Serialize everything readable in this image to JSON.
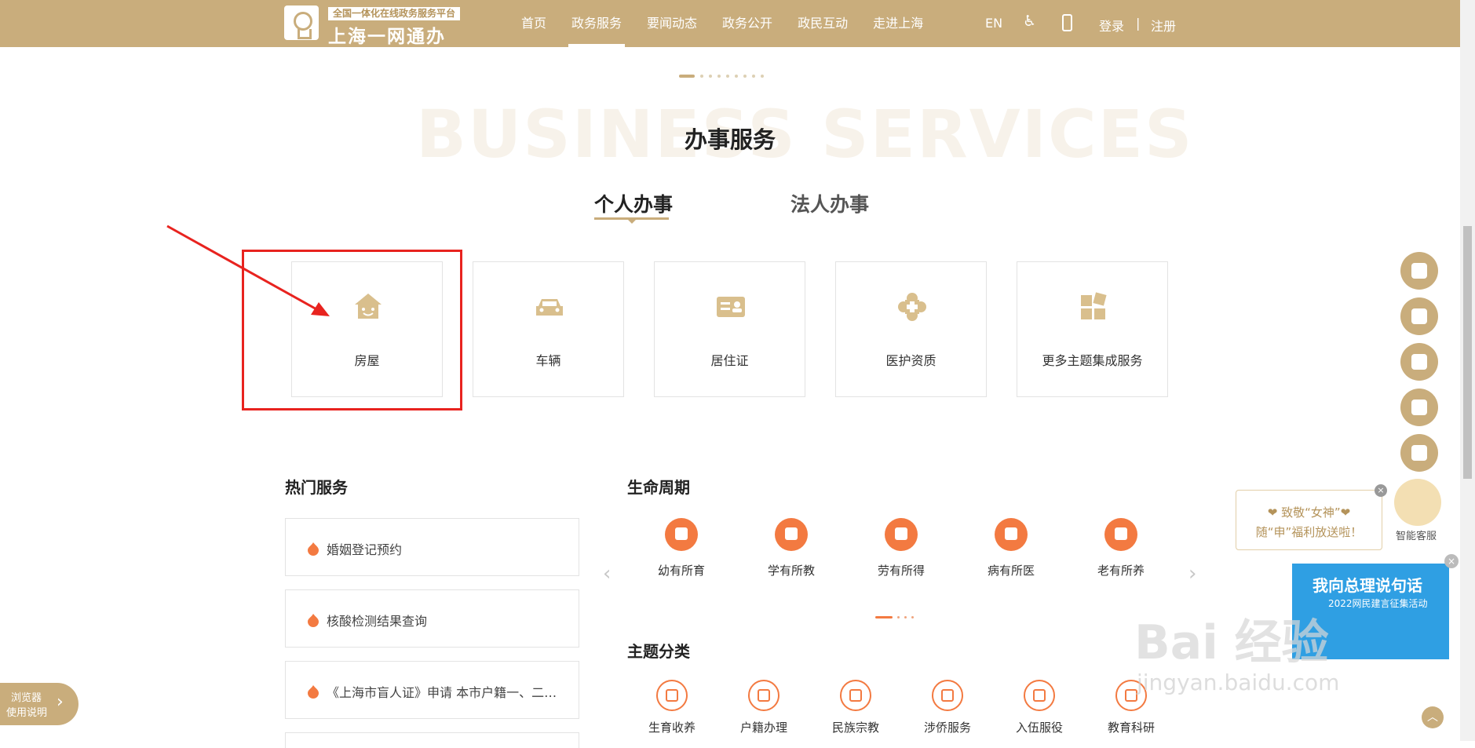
{
  "header": {
    "logo_tagline": "全国一体化在线政务服务平台",
    "logo_name": "上海一网通办",
    "nav": [
      "首页",
      "政务服务",
      "要闻动态",
      "政务公开",
      "政民互动",
      "走进上海"
    ],
    "active_nav": "政务服务",
    "lang": "EN",
    "login": "登录",
    "separator": "|",
    "register": "注册"
  },
  "section": {
    "bg_title": "BUSINESS SERVICES",
    "title": "办事服务",
    "tabs": [
      "个人办事",
      "法人办事"
    ],
    "active_tab": "个人办事"
  },
  "cards": [
    {
      "label": "房屋",
      "icon": "house-icon"
    },
    {
      "label": "车辆",
      "icon": "car-icon"
    },
    {
      "label": "居住证",
      "icon": "id-card-icon"
    },
    {
      "label": "医护资质",
      "icon": "medical-cross-icon"
    },
    {
      "label": "更多主题集成服务",
      "icon": "grid-icon"
    }
  ],
  "hot": {
    "title": "热门服务",
    "items": [
      "婚姻登记预约",
      "核酸检测结果查询",
      "《上海市盲人证》申请 本市户籍一、二…"
    ]
  },
  "life": {
    "title": "生命周期",
    "items": [
      "幼有所育",
      "学有所教",
      "劳有所得",
      "病有所医",
      "老有所养"
    ]
  },
  "topics": {
    "title": "主题分类",
    "items": [
      "生育收养",
      "户籍办理",
      "民族宗教",
      "涉侨服务",
      "入伍服役",
      "教育科研"
    ]
  },
  "assistant": {
    "line1": "❤ 致敬“女神”❤",
    "line2": "随“申”福利放送啦！",
    "bot_label": "智能客服"
  },
  "ad": {
    "line1": "我向总理说句话",
    "line2": "2022网民建言征集活动"
  },
  "browser_tip": {
    "line1": "浏览器",
    "line2": "使用说明"
  },
  "watermark": {
    "line1": "Bai 经验",
    "line2": "jingyan.baidu.com"
  },
  "colors": {
    "brand": "#c9ad7c",
    "accent": "#f37a41",
    "highlight": "#e8231f"
  }
}
